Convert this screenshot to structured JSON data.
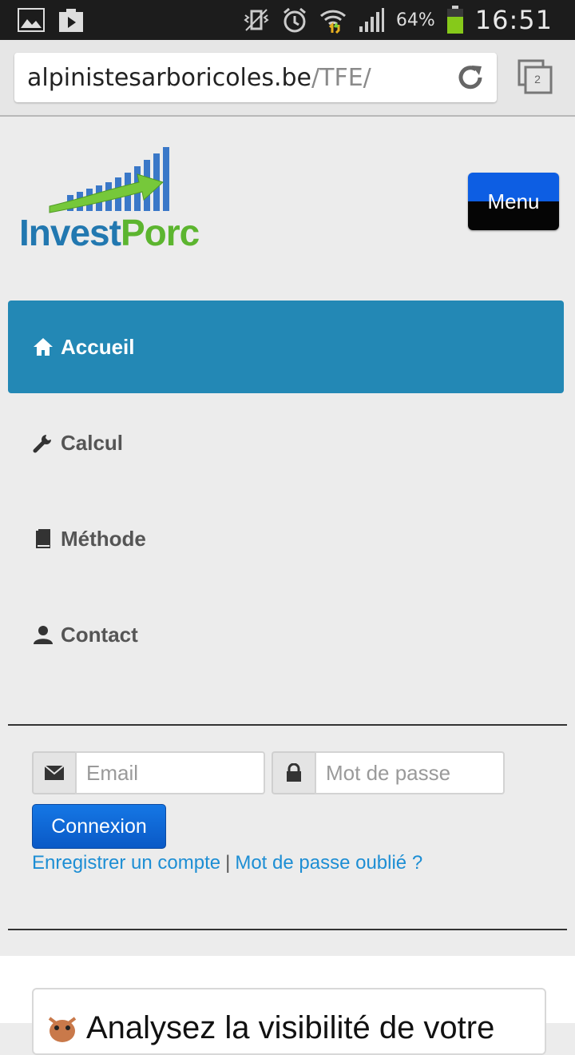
{
  "status_bar": {
    "battery_percent": "64%",
    "time": "16:51"
  },
  "browser": {
    "url_domain": "alpinistesarboricoles.be",
    "url_path": "/TFE/",
    "tab_count": "2"
  },
  "header": {
    "logo_invest": "Invest",
    "logo_porc": "Porc",
    "menu_label": "Menu"
  },
  "nav": {
    "items": [
      {
        "label": "Accueil",
        "icon": "home-icon",
        "active": true
      },
      {
        "label": "Calcul",
        "icon": "wrench-icon"
      },
      {
        "label": "Méthode",
        "icon": "book-icon"
      },
      {
        "label": "Contact",
        "icon": "user-icon"
      }
    ]
  },
  "login": {
    "email_placeholder": "Email",
    "password_placeholder": "Mot de passe",
    "submit_label": "Connexion",
    "register_link": "Enregistrer un compte",
    "separator": "|",
    "forgot_link": "Mot de passe oublié ?"
  },
  "ad": {
    "text": "Analysez la visibilité de votre"
  },
  "colors": {
    "active_nav": "#2388b5",
    "link": "#1d8ed4",
    "logo_blue": "#2278b0",
    "logo_green": "#5cb52f"
  }
}
